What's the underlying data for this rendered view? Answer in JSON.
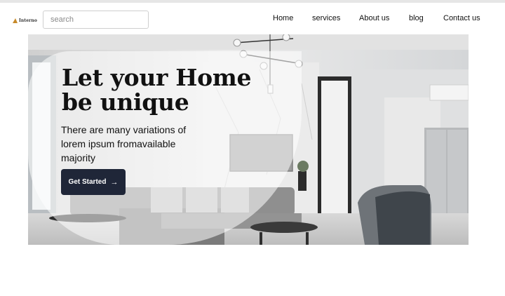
{
  "header": {
    "logo_text": "Interno",
    "search_placeholder": "search",
    "nav": [
      {
        "label": "Home"
      },
      {
        "label": "services"
      },
      {
        "label": "About us"
      },
      {
        "label": "blog"
      },
      {
        "label": "Contact us"
      }
    ]
  },
  "hero": {
    "headline": "Let your Home be unique",
    "subtext": "There are many variations of lorem ipsum fromavailable majority",
    "cta_label": "Get Started",
    "cta_icon": "arrow-right-icon"
  },
  "colors": {
    "button_bg": "#1f2638",
    "logo_accent": "#c78a2a"
  }
}
